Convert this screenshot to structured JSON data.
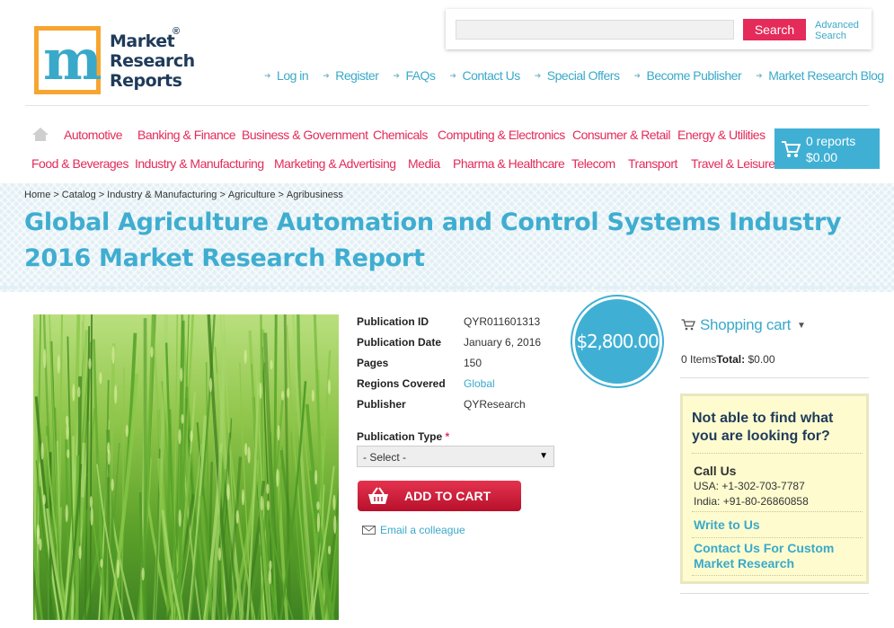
{
  "logo": {
    "line1": "Market",
    "line2": "Research",
    "line3": "Reports",
    "mark": "m",
    "registered": "®"
  },
  "search": {
    "placeholder": "",
    "button_label": "Search",
    "advanced_label": "Advanced Search"
  },
  "top_links": [
    "Log in",
    "Register",
    "FAQs",
    "Contact Us",
    "Special Offers",
    "Become Publisher",
    "Market Research Blog"
  ],
  "categories_row1": [
    "Automotive",
    "Banking & Finance",
    "Business & Government",
    "Chemicals",
    "Computing & Electronics",
    "Consumer & Retail",
    "Energy & Utilities"
  ],
  "categories_row2": [
    "Food & Beverages",
    "Industry & Manufacturing",
    "Marketing & Advertising",
    "Media",
    "Pharma & Healthcare",
    "Telecom",
    "Transport",
    "Travel & Leisure"
  ],
  "cart": {
    "count_label": "0 reports",
    "total_label": "$0.00"
  },
  "breadcrumb": [
    "Home",
    "Catalog",
    "Industry & Manufacturing",
    "Agriculture",
    "Agribusiness"
  ],
  "page_title": "Global Agriculture Automation and Control Systems Industry 2016 Market Research Report",
  "details": {
    "publication_id": {
      "label": "Publication ID",
      "value": "QYR011601313"
    },
    "publication_date": {
      "label": "Publication Date",
      "value": "January 6, 2016"
    },
    "pages": {
      "label": "Pages",
      "value": "150"
    },
    "regions": {
      "label": "Regions Covered",
      "value": "Global"
    },
    "publisher": {
      "label": "Publisher",
      "value": "QYResearch"
    }
  },
  "price": "$2,800.00",
  "publication_type": {
    "label": "Publication Type",
    "required_mark": "*",
    "selected": "- Select -"
  },
  "add_to_cart_label": "ADD TO CART",
  "email_colleague_label": "Email a colleague",
  "sidebar": {
    "shopping_cart_title": "Shopping cart",
    "items_label": "0 Items",
    "total_label": "Total:",
    "total_value": " $0.00",
    "help_title": "Not able to find what you are looking for?",
    "call_us": "Call Us",
    "phone_usa": "USA: +1-302-703-7787",
    "phone_india": "India: +91-80-26860858",
    "write_to_us": "Write to Us",
    "contact_custom": "Contact Us For Custom Market Research"
  },
  "colors": {
    "accent_blue": "#3fb0d4",
    "category_pink": "#e42b59",
    "cart_red": "#c8203b",
    "help_bg": "#fefccf"
  }
}
